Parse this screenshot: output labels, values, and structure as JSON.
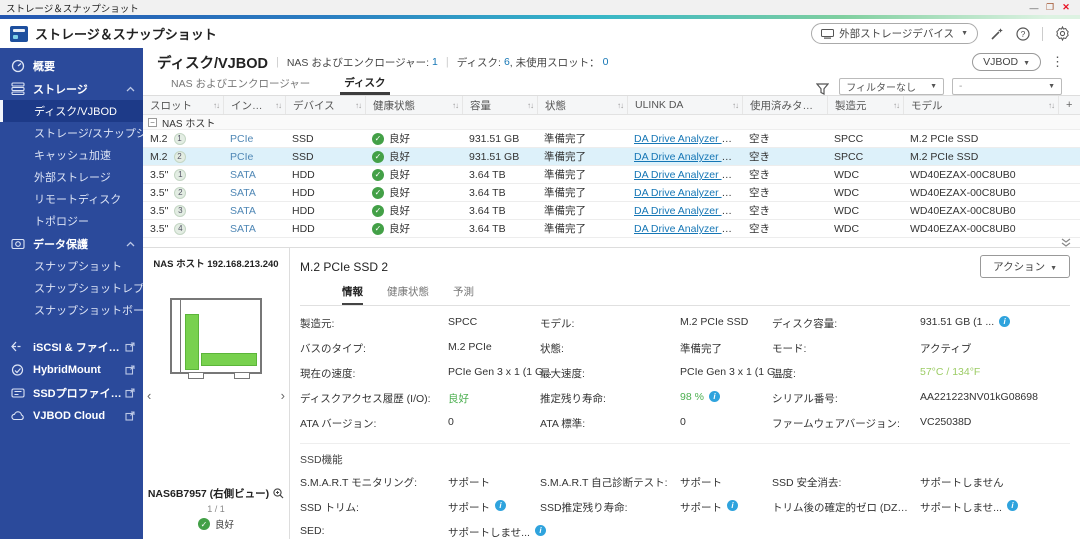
{
  "window": {
    "title": "ストレージ＆スナップショット",
    "minimize": "—",
    "close": "✕"
  },
  "header": {
    "app_title": "ストレージ＆スナップショット",
    "external_device_button": "外部ストレージデバイス"
  },
  "sidebar": {
    "overview": "概要",
    "storage_section": "ストレージ",
    "storage_items": [
      "ディスク/VJBOD",
      "ストレージ/スナップショ...",
      "キャッシュ加速",
      "外部ストレージ",
      "リモートディスク",
      "トポロジー"
    ],
    "protection_section": "データ保護",
    "protection_items": [
      "スナップショット",
      "スナップショットレプリカ",
      "スナップショットボールト"
    ],
    "external_items": [
      "iSCSI & ファイバー...",
      "HybridMount",
      "SSDプロファイリン...",
      "VJBOD Cloud"
    ]
  },
  "page": {
    "title": "ディスク/VJBOD",
    "summary1_label": "NAS およびエンクロージャー:",
    "summary1_value": "1",
    "summary2_label": "ディスク:",
    "summary2_value": "6",
    "summary2_label2": ", 未使用スロット：",
    "summary2_value2": "0",
    "vjbod_button": "VJBOD",
    "tab_nas": "NAS およびエンクロージャー",
    "tab_disk": "ディスク",
    "filter_none": "フィルターなし",
    "filter_secondary": "-"
  },
  "table": {
    "columns": [
      {
        "label": "スロット"
      },
      {
        "label": "インター..."
      },
      {
        "label": "デバイス"
      },
      {
        "label": "健康状態"
      },
      {
        "label": "容量"
      },
      {
        "label": "状態"
      },
      {
        "label": "ULINK DA"
      },
      {
        "label": "使用済みタイプ"
      },
      {
        "label": "製造元"
      },
      {
        "label": "モデル"
      }
    ],
    "add_column": "+",
    "group": "NAS ホスト",
    "rows": [
      {
        "slot": "M.2",
        "num": "1",
        "iface": "PCIe",
        "device": "SSD",
        "health": "良好",
        "capacity": "931.51 GB",
        "status": "準備完了",
        "ulink": "DA Drive Analyzer を有効化",
        "used": "空き",
        "vendor": "SPCC",
        "model": "M.2 PCIe SSD"
      },
      {
        "slot": "M.2",
        "num": "2",
        "iface": "PCIe",
        "device": "SSD",
        "health": "良好",
        "capacity": "931.51 GB",
        "status": "準備完了",
        "ulink": "DA Drive Analyzer を有効化",
        "used": "空き",
        "vendor": "SPCC",
        "model": "M.2 PCIe SSD"
      },
      {
        "slot": "3.5\"",
        "num": "1",
        "iface": "SATA",
        "device": "HDD",
        "health": "良好",
        "capacity": "3.64 TB",
        "status": "準備完了",
        "ulink": "DA Drive Analyzer を有効化",
        "used": "空き",
        "vendor": "WDC",
        "model": "WD40EZAX-00C8UB0"
      },
      {
        "slot": "3.5\"",
        "num": "2",
        "iface": "SATA",
        "device": "HDD",
        "health": "良好",
        "capacity": "3.64 TB",
        "status": "準備完了",
        "ulink": "DA Drive Analyzer を有効化",
        "used": "空き",
        "vendor": "WDC",
        "model": "WD40EZAX-00C8UB0"
      },
      {
        "slot": "3.5\"",
        "num": "3",
        "iface": "SATA",
        "device": "HDD",
        "health": "良好",
        "capacity": "3.64 TB",
        "status": "準備完了",
        "ulink": "DA Drive Analyzer を有効化",
        "used": "空き",
        "vendor": "WDC",
        "model": "WD40EZAX-00C8UB0"
      },
      {
        "slot": "3.5\"",
        "num": "4",
        "iface": "SATA",
        "device": "HDD",
        "health": "良好",
        "capacity": "3.64 TB",
        "status": "準備完了",
        "ulink": "DA Drive Analyzer を有効化",
        "used": "空き",
        "vendor": "WDC",
        "model": "WD40EZAX-00C8UB0"
      }
    ]
  },
  "detail": {
    "nas_host": "NAS ホスト 192.168.213.240",
    "enclosure_name": "NAS6B7957 (右側ビュー)",
    "page_indicator": "1 / 1",
    "enclosure_health": "良好",
    "title": "M.2 PCIe SSD 2",
    "action_button": "アクション",
    "tabs": [
      "情報",
      "健康状態",
      "予測"
    ],
    "info_fields": [
      {
        "label": "製造元:",
        "value": "SPCC"
      },
      {
        "label": "モデル:",
        "value": "M.2 PCIe SSD"
      },
      {
        "label": "ディスク容量:",
        "value": "931.51 GB (1 ..."
      },
      {
        "label": "バスのタイプ:",
        "value": "M.2 PCIe"
      },
      {
        "label": "状態:",
        "value": "準備完了"
      },
      {
        "label": "モード:",
        "value": "アクティブ"
      },
      {
        "label": "現在の速度:",
        "value": "PCIe Gen 3 x 1 (1 G..."
      },
      {
        "label": "最大速度:",
        "value": "PCIe Gen 3 x 1 (1 G..."
      },
      {
        "label": "温度:",
        "value": "57°C / 134°F"
      },
      {
        "label": "ディスクアクセス履歴 (I/O):",
        "value": "良好"
      },
      {
        "label": "推定残り寿命:",
        "value": "98 %"
      },
      {
        "label": "シリアル番号:",
        "value": "AA221223NV01kG08698"
      },
      {
        "label": "ATA バージョン:",
        "value": "0"
      },
      {
        "label": "ATA 標準:",
        "value": "0"
      },
      {
        "label": "ファームウェアバージョン:",
        "value": "VC25038D"
      }
    ],
    "ssd_section": "SSD機能",
    "ssd_fields": [
      {
        "label": "S.M.A.R.T モニタリング:",
        "value": "サポート"
      },
      {
        "label": "S.M.A.R.T 自己診断テスト:",
        "value": "サポート"
      },
      {
        "label": "SSD 安全消去:",
        "value": "サポートしません"
      },
      {
        "label": "SSD トリム:",
        "value": "サポート"
      },
      {
        "label": "SSD推定残り寿命:",
        "value": "サポート"
      },
      {
        "label": "トリム後の確定的ゼロ (DZAT):",
        "value": "サポートしませ..."
      },
      {
        "label": "SED:",
        "value": "サポートしませ..."
      }
    ]
  },
  "colors": {
    "sidebar_bg": "#2b4a9b",
    "sidebar_active": "#1d3a88",
    "link": "#1576b5",
    "good": "#4caf50",
    "temperature": "#9ccc65",
    "selected_row": "#ddf1fa",
    "info_icon": "#2fa3dd",
    "close_button": "#e81123",
    "drive_bar": "#78d14e"
  }
}
